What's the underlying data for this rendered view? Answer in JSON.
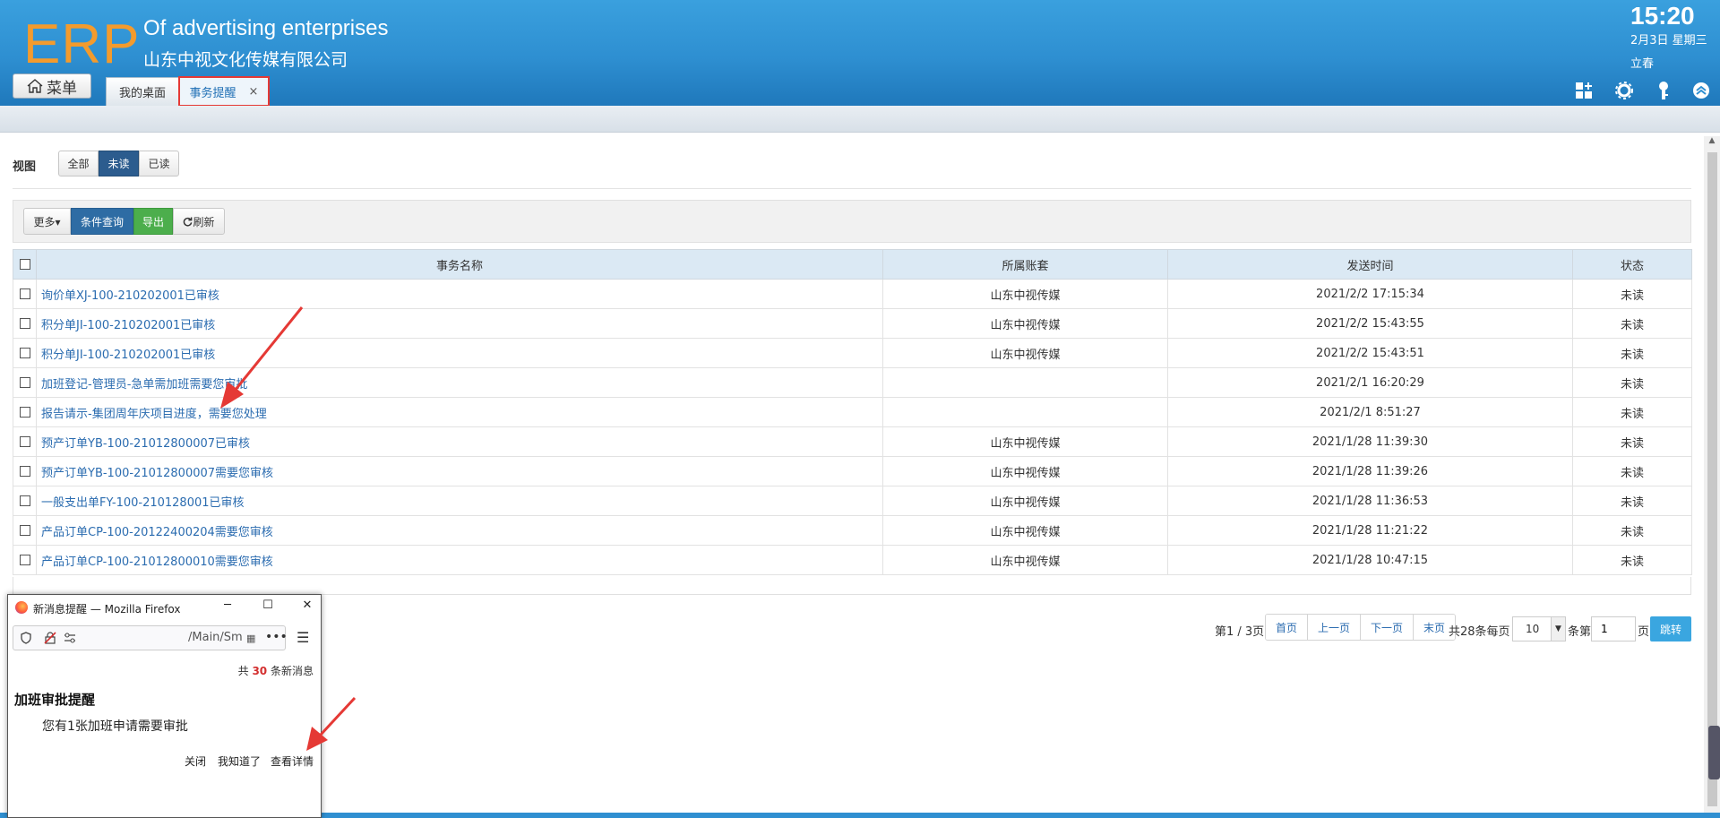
{
  "header": {
    "logo": "ERP",
    "company_en": "Of advertising enterprises",
    "company_cn": "山东中视文化传媒有限公司",
    "time": "15:20",
    "date": "2月3日 星期三",
    "solar_term": "立春",
    "menu_label": "菜单",
    "tabs": [
      {
        "label": "我的桌面"
      },
      {
        "label": "事务提醒",
        "close": "×"
      }
    ],
    "icons": [
      "grid-add-icon",
      "gear-icon",
      "key-icon",
      "collapse-up-icon"
    ]
  },
  "view": {
    "label": "视图",
    "options": [
      "全部",
      "未读",
      "已读"
    ],
    "selected": "未读"
  },
  "toolbar": {
    "more": "更多▾",
    "query": "条件查询",
    "export": "导出",
    "refresh": "刷新"
  },
  "table": {
    "columns": [
      "事务名称",
      "所属账套",
      "发送时间",
      "状态"
    ],
    "rows": [
      {
        "name": "询价单XJ-100-210202001已审核",
        "account": "山东中视传媒",
        "time": "2021/2/2 17:15:34",
        "status": "未读"
      },
      {
        "name": "积分单JI-100-210202001已审核",
        "account": "山东中视传媒",
        "time": "2021/2/2 15:43:55",
        "status": "未读"
      },
      {
        "name": "积分单JI-100-210202001已审核",
        "account": "山东中视传媒",
        "time": "2021/2/2 15:43:51",
        "status": "未读"
      },
      {
        "name": "加班登记-管理员-急单需加班需要您审批",
        "account": "",
        "time": "2021/2/1 16:20:29",
        "status": "未读"
      },
      {
        "name": "报告请示-集团周年庆项目进度，需要您处理",
        "account": "",
        "time": "2021/2/1 8:51:27",
        "status": "未读"
      },
      {
        "name": "预产订单YB-100-21012800007已审核",
        "account": "山东中视传媒",
        "time": "2021/1/28 11:39:30",
        "status": "未读"
      },
      {
        "name": "预产订单YB-100-21012800007需要您审核",
        "account": "山东中视传媒",
        "time": "2021/1/28 11:39:26",
        "status": "未读"
      },
      {
        "name": "一般支出单FY-100-210128001已审核",
        "account": "山东中视传媒",
        "time": "2021/1/28 11:36:53",
        "status": "未读"
      },
      {
        "name": "产品订单CP-100-20122400204需要您审核",
        "account": "山东中视传媒",
        "time": "2021/1/28 11:21:22",
        "status": "未读"
      },
      {
        "name": "产品订单CP-100-21012800010需要您审核",
        "account": "山东中视传媒",
        "time": "2021/1/28 10:47:15",
        "status": "未读"
      }
    ]
  },
  "pagination": {
    "page_info": "第1 / 3页",
    "first": "首页",
    "prev": "上一页",
    "next": "下一页",
    "last": "末页",
    "total_text": "共28条每页",
    "per_page": "10",
    "per_page_suffix": "条第",
    "page_input": "1",
    "page_suffix": "页",
    "go": "跳转"
  },
  "popup": {
    "window_title": "新消息提醒 — Mozilla Firefox",
    "url": "/Main/Sm",
    "count_prefix": "共",
    "count": "30",
    "count_suffix": "条新消息",
    "heading": "加班审批提醒",
    "body": "您有1张加班申请需要审批",
    "actions": [
      "关闭",
      "我知道了",
      "查看详情"
    ]
  },
  "colors": {
    "header_blue": "#2e8fd1",
    "logo_orange": "#f39b2d",
    "highlight_red": "#e53935",
    "link_blue": "#2b6cb0",
    "selected_seg": "#2c5c8e",
    "export_green": "#4cae4c"
  }
}
